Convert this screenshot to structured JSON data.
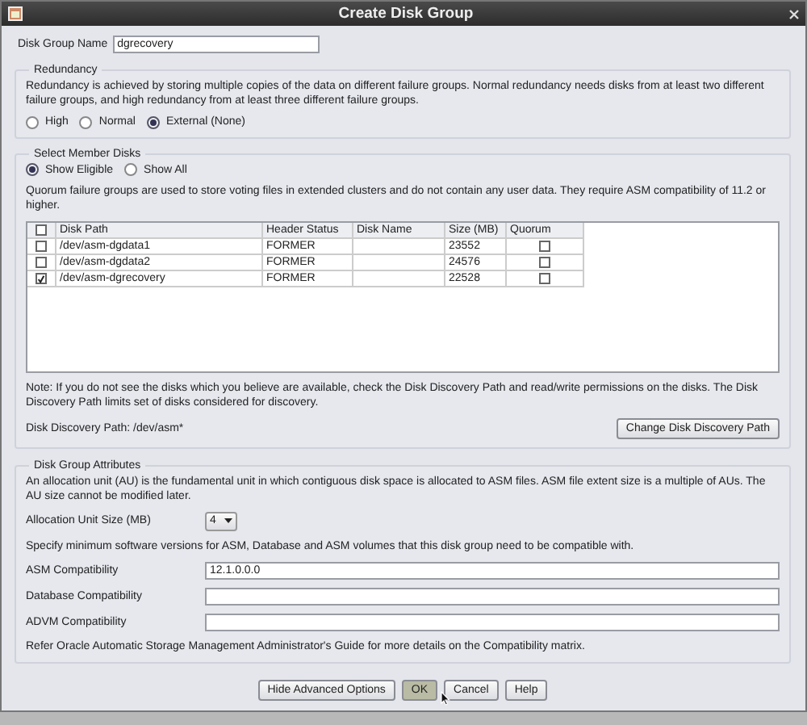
{
  "window": {
    "title": "Create Disk Group"
  },
  "disk_group_name": {
    "label": "Disk Group Name",
    "value": "dgrecovery"
  },
  "redundancy": {
    "title": "Redundancy",
    "description": "Redundancy is achieved by storing multiple copies of the data on different failure groups. Normal redundancy needs disks from at least two different failure groups, and high redundancy from at least three different failure groups.",
    "options": [
      {
        "label": "High",
        "selected": false
      },
      {
        "label": "Normal",
        "selected": false
      },
      {
        "label": "External (None)",
        "selected": true
      }
    ]
  },
  "member_disks": {
    "title": "Select Member Disks",
    "filters": [
      {
        "label": "Show Eligible",
        "selected": true
      },
      {
        "label": "Show All",
        "selected": false
      }
    ],
    "description": "Quorum failure groups are used to store voting files in extended clusters and do not contain any user data. They require ASM compatibility of 11.2 or higher.",
    "table": {
      "select_all_checked": false,
      "columns": [
        "Disk Path",
        "Header Status",
        "Disk Name",
        "Size (MB)",
        "Quorum"
      ],
      "rows": [
        {
          "checked": false,
          "path": "/dev/asm-dgdata1",
          "header_status": "FORMER",
          "size": "23552",
          "quorum": false
        },
        {
          "checked": false,
          "path": "/dev/asm-dgdata2",
          "header_status": "FORMER",
          "size": "24576",
          "quorum": false
        },
        {
          "checked": true,
          "path": "/dev/asm-dgrecovery",
          "header_status": "FORMER",
          "size": "22528",
          "quorum": false
        }
      ]
    },
    "note": "Note: If you do not see the disks which you believe are available, check the Disk Discovery Path and read/write permissions on the disks. The Disk Discovery Path limits set of disks considered for discovery.",
    "discovery_path": "Disk Discovery Path: /dev/asm*",
    "change_path_button": "Change Disk Discovery Path"
  },
  "attributes": {
    "title": "Disk Group Attributes",
    "description": "An allocation unit (AU) is the fundamental unit in which contiguous disk space is allocated to ASM files. ASM file extent size is a multiple of AUs. The AU size cannot be modified later.",
    "allocation_unit": {
      "label": "Allocation Unit Size (MB)",
      "value": "4"
    },
    "compat_note": "Specify minimum software versions for ASM, Database and ASM volumes that this disk group need to be compatible with.",
    "fields": [
      {
        "label": "ASM Compatibility",
        "value": "12.1.0.0.0"
      },
      {
        "label": "Database Compatibility"
      },
      {
        "label": "ADVM Compatibility"
      }
    ],
    "reference": "Refer Oracle Automatic Storage Management Administrator's Guide for more details on the Compatibility matrix."
  },
  "buttons": [
    {
      "label": "Hide Advanced Options",
      "focused": false
    },
    {
      "label": "OK",
      "focused": true
    },
    {
      "label": "Cancel",
      "focused": false
    },
    {
      "label": "Help",
      "focused": false
    }
  ]
}
